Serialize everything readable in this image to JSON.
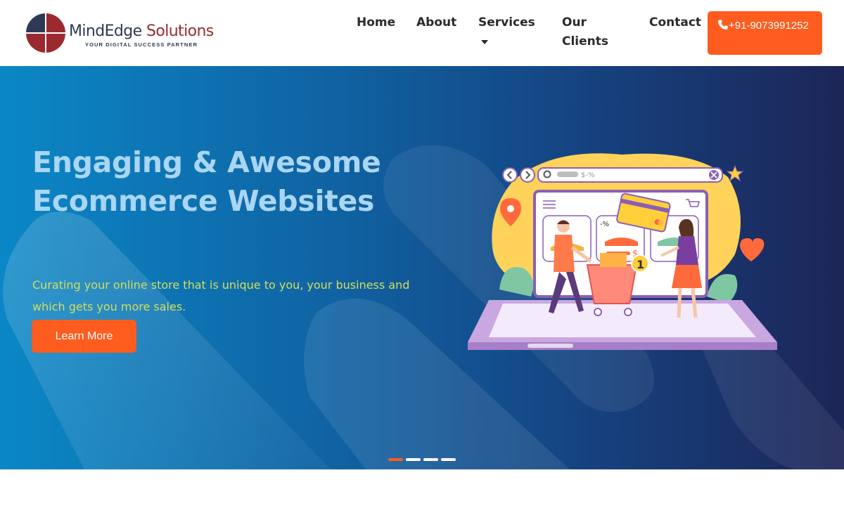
{
  "brand": {
    "name_part1": "MindEdge",
    "name_part2": " Solutions",
    "tagline": "YOUR DIGITAL SUCCESS PARTNER",
    "colors": {
      "navy": "#2d3a55",
      "maroon": "#9b2a30"
    }
  },
  "nav": {
    "home": "Home",
    "about": "About",
    "services": "Services",
    "clients": "Our Clients",
    "contact": "Contact",
    "phone": "+91-9073991252",
    "phone_icon": "phone-icon"
  },
  "hero": {
    "title_line1": "Engaging & Awesome",
    "title_line2": "Ecommerce Websites",
    "subtitle": "Curating your online store that is unique to you, your business and which gets you more sales.",
    "cta": "Learn More",
    "illustration": {
      "search_text": "$-%",
      "discount_label": "-%",
      "price_symbol": "$",
      "cart_count": "1"
    },
    "slides": {
      "count": 4,
      "active": 1
    }
  },
  "colors": {
    "accent": "#ff5c1f",
    "hero_start": "#0b87c6",
    "hero_end": "#1d2557",
    "subtitle": "#d3df5a",
    "title": "#a9d6f2"
  }
}
